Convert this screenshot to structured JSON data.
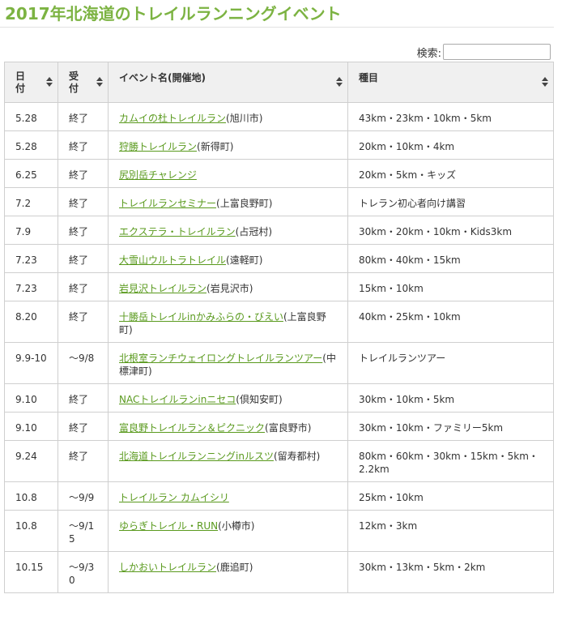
{
  "page": {
    "title": "2017年北海道のトレイルランニングイベント"
  },
  "search": {
    "label": "検索:",
    "value": ""
  },
  "columns": {
    "date": "日付",
    "status": "受付",
    "name": "イベント名(開催地)",
    "category": "種目"
  },
  "rows": [
    {
      "date": "5.28",
      "status": "終了",
      "name": "カムイの杜トレイルラン",
      "place": "(旭川市)",
      "category": "43km・23km・10km・5km"
    },
    {
      "date": "5.28",
      "status": "終了",
      "name": "狩勝トレイルラン",
      "place": "(新得町)",
      "category": "20km・10km・4km"
    },
    {
      "date": "6.25",
      "status": "終了",
      "name": "尻別岳チャレンジ",
      "place": "",
      "category": "20km・5km・キッズ"
    },
    {
      "date": "7.2",
      "status": "終了",
      "name": "トレイルランセミナー",
      "place": "(上富良野町)",
      "category": "トレラン初心者向け講習"
    },
    {
      "date": "7.9",
      "status": "終了",
      "name": "エクステラ・トレイルラン",
      "place": "(占冠村)",
      "category": "30km・20km・10km・Kids3km"
    },
    {
      "date": "7.23",
      "status": "終了",
      "name": "大雪山ウルトラトレイル",
      "place": "(遠軽町)",
      "category": "80km・40km・15km"
    },
    {
      "date": "7.23",
      "status": "終了",
      "name": "岩見沢トレイルラン",
      "place": "(岩見沢市)",
      "category": "15km・10km"
    },
    {
      "date": "8.20",
      "status": "終了",
      "name": "十勝岳トレイルinかみふらの・びえい",
      "place": "(上富良野町)",
      "category": "40km・25km・10km"
    },
    {
      "date": "9.9-10",
      "status": "〜9/8",
      "name": "北根室ランチウェイロングトレイルランツアー",
      "place": "(中標津町)",
      "category": "トレイルランツアー"
    },
    {
      "date": "9.10",
      "status": "終了",
      "name": "NACトレイルランinニセコ",
      "place": "(倶知安町)",
      "category": "30km・10km・5km"
    },
    {
      "date": "9.10",
      "status": "終了",
      "name": "富良野トレイルラン＆ピクニック",
      "place": "(富良野市)",
      "category": "30km・10km・ファミリー5km"
    },
    {
      "date": "9.24",
      "status": "終了",
      "name": "北海道トレイルランニングinルスツ",
      "place": "(留寿都村)",
      "category": "80km・60km・30km・15km・5km・2.2km"
    },
    {
      "date": "10.8",
      "status": "〜9/9",
      "name": "トレイルラン カムイシリ",
      "place": "",
      "category": "25km・10km"
    },
    {
      "date": "10.8",
      "status": "〜9/15",
      "name": "ゆらぎトレイル・RUN",
      "place": "(小樽市)",
      "category": "12km・3km"
    },
    {
      "date": "10.15",
      "status": "〜9/30",
      "name": "しかおいトレイルラン",
      "place": "(鹿追町)",
      "category": "30km・13km・5km・2km"
    }
  ],
  "colors": {
    "title": "#7cb342",
    "link": "#5a9a1e",
    "header_bg": "#f0f0f0",
    "border": "#cfcfcf"
  },
  "icons": {
    "sort": "sort-both-icon"
  }
}
